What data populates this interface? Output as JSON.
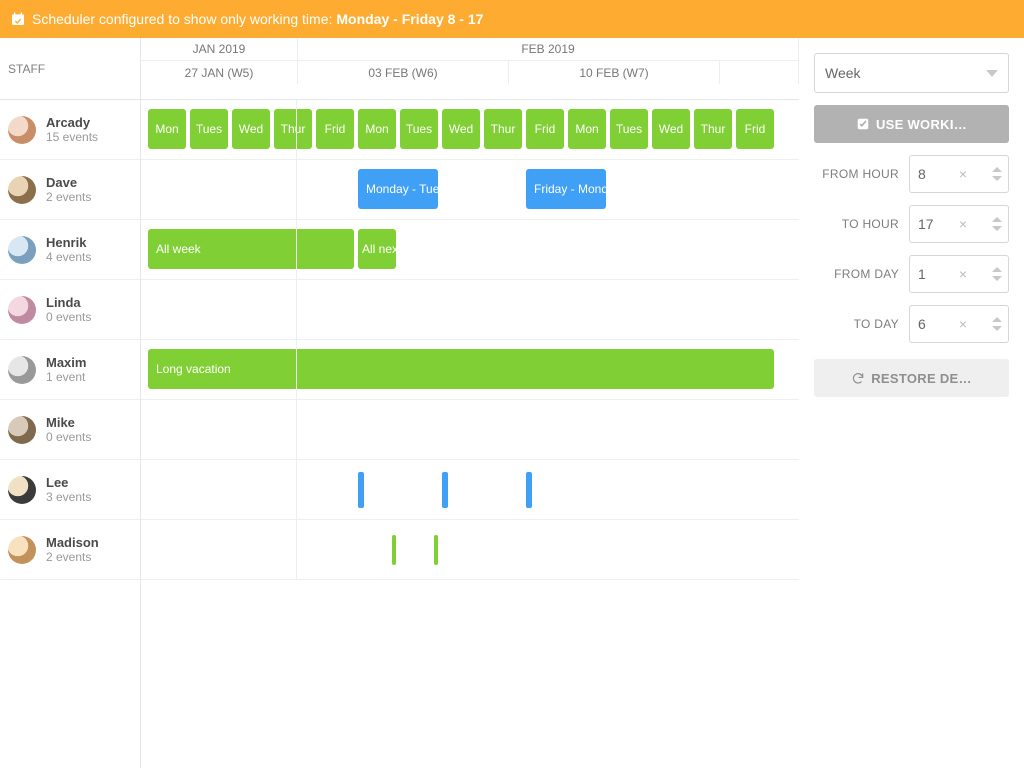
{
  "banner": {
    "prefix": "Scheduler configured to show only working time:",
    "range": "Monday - Friday 8 - 17"
  },
  "staff_header": "STAFF",
  "months": {
    "m1": "JAN 2019",
    "m2": "FEB 2019"
  },
  "weeks": {
    "w1": "27 JAN (W5)",
    "w2": "03 FEB (W6)",
    "w3": "10 FEB (W7)"
  },
  "days": [
    "Mon",
    "Tues",
    "Wed",
    "Thur",
    "Frid",
    "Mon",
    "Tues",
    "Wed",
    "Thur",
    "Frid",
    "Mon",
    "Tues",
    "Wed",
    "Thur",
    "Frid"
  ],
  "staff": [
    {
      "name": "Arcady",
      "sub": "15 events"
    },
    {
      "name": "Dave",
      "sub": "2 events"
    },
    {
      "name": "Henrik",
      "sub": "4 events"
    },
    {
      "name": "Linda",
      "sub": "0 events"
    },
    {
      "name": "Maxim",
      "sub": "1 event"
    },
    {
      "name": "Mike",
      "sub": "0 events"
    },
    {
      "name": "Lee",
      "sub": "3 events"
    },
    {
      "name": "Madison",
      "sub": "2 events"
    }
  ],
  "events": {
    "dave_mon": "Monday - Tuesday",
    "dave_fri": "Friday - Monday",
    "henrik_a": "All week",
    "henrik_b": "All next week",
    "maxim": "Long vacation"
  },
  "side": {
    "select": "Week",
    "btn_working": "USE WORKI…",
    "from_hour_l": "FROM HOUR",
    "to_hour_l": "TO HOUR",
    "from_day_l": "FROM DAY",
    "to_day_l": "TO DAY",
    "from_hour": "8",
    "to_hour": "17",
    "from_day": "1",
    "to_day": "6",
    "btn_restore": "RESTORE DE…"
  }
}
